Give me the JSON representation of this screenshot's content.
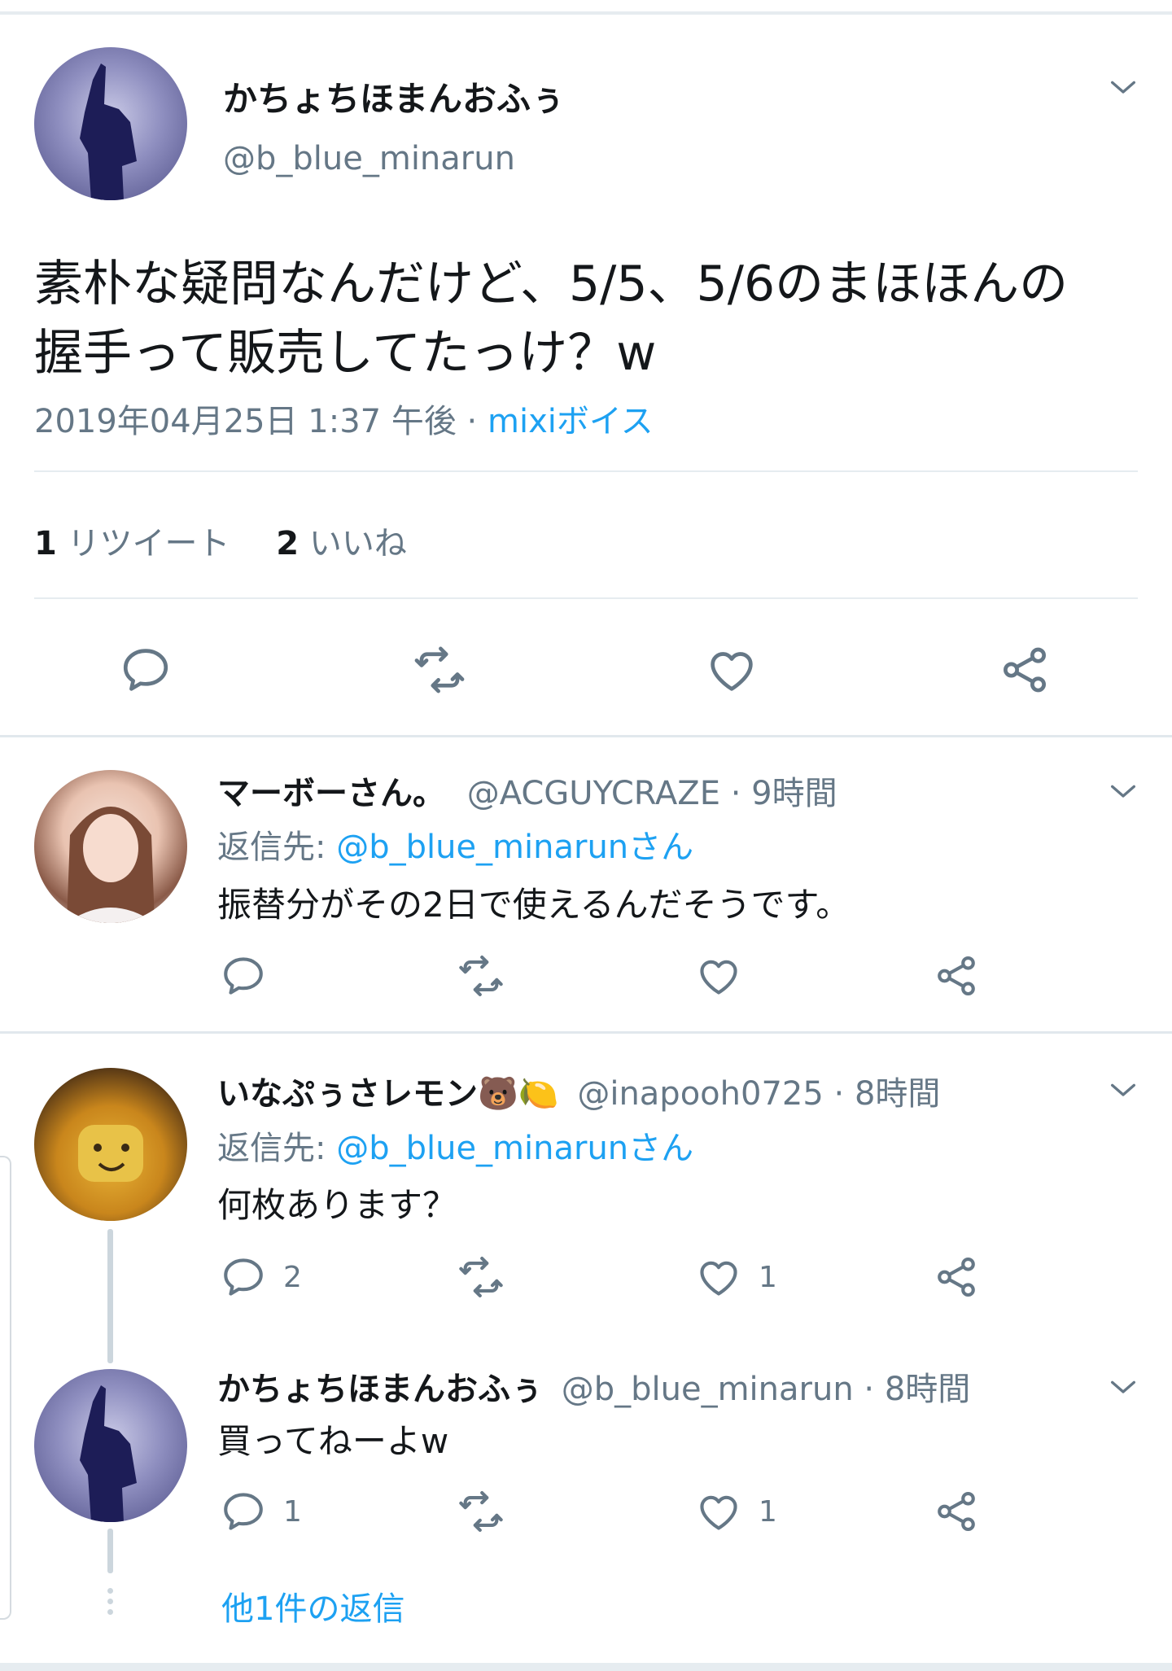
{
  "main_tweet": {
    "display_name": "かちょちほまんおふぅ",
    "handle": "@b_blue_minarun",
    "text_line1": "素朴な疑問なんだけど、5/5、5/6のまほほんの",
    "text_line2": "握手って販売してたっけ？w",
    "timestamp": "2019年04月25日 1:37 午後 ·",
    "source": "mixiボイス",
    "retweet_count": "1",
    "retweet_label": "リツイート",
    "like_count": "2",
    "like_label": "いいね"
  },
  "replies": [
    {
      "display_name": "マーボーさん。",
      "handle": "@ACGUYCRAZE",
      "time": "· 9時間",
      "reply_to_label": "返信先:",
      "reply_to_handle": "@b_blue_minarunさん",
      "text": "振替分がその2日で使えるんだそうです。",
      "reply_count": "",
      "like_count": ""
    },
    {
      "display_name": "いなぷぅさレモン🐻🍋",
      "handle": "@inapooh0725",
      "time": "· 8時間",
      "reply_to_label": "返信先:",
      "reply_to_handle": "@b_blue_minarunさん",
      "text": "何枚あります？",
      "reply_count": "2",
      "like_count": "1"
    },
    {
      "display_name": "かちょちほまんおふぅ",
      "handle": "@b_blue_minarun",
      "time": "· 8時間",
      "text": "買ってねーよw",
      "reply_count": "1",
      "like_count": "1"
    }
  ],
  "more_replies_label": "他1件の返信",
  "icons": {
    "reply": "reply-icon",
    "retweet": "retweet-icon",
    "like": "heart-icon",
    "share": "share-icon",
    "menu": "chevron-down-icon"
  },
  "colors": {
    "link": "#1da1f2",
    "muted": "#657786",
    "text": "#14171a",
    "divider": "#e6ecf0"
  }
}
